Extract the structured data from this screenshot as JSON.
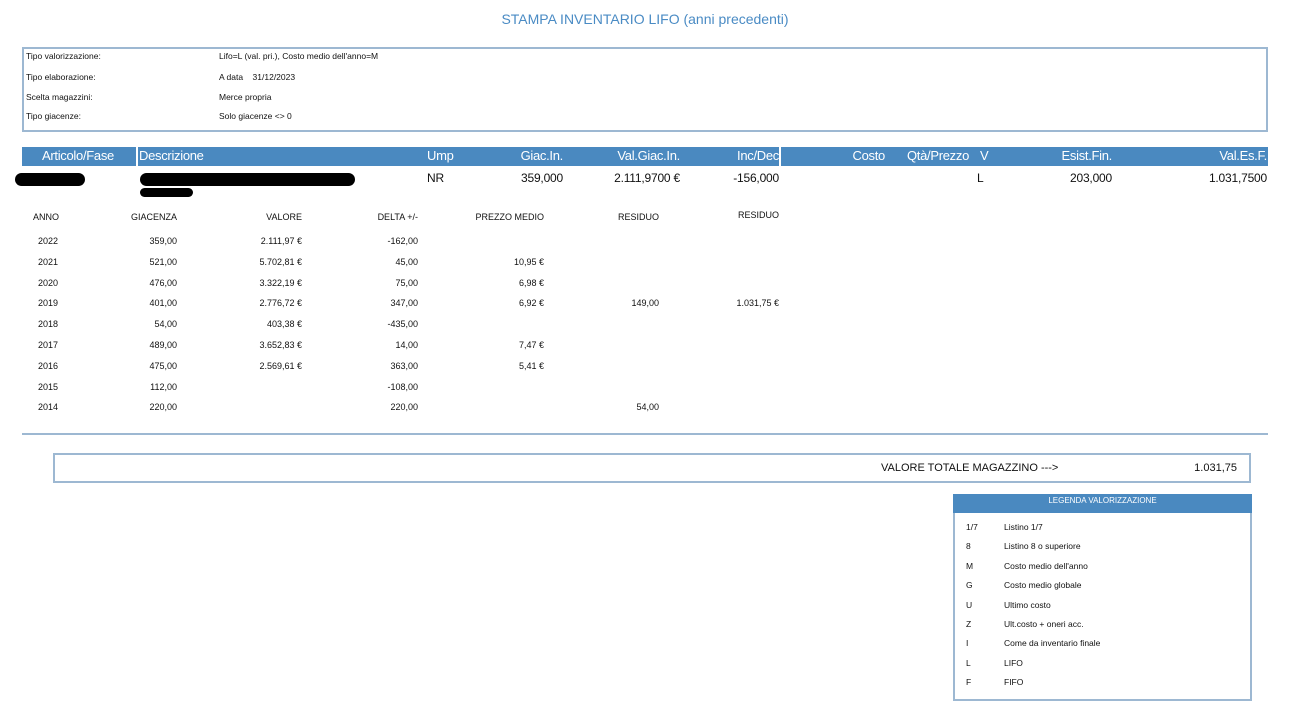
{
  "title": "STAMPA INVENTARIO LIFO (anni precedenti)",
  "info": [
    {
      "label": "Tipo valorizzazione:",
      "value": "Lifo=L (val. pri.), Costo medio dell'anno=M"
    },
    {
      "label": "Tipo elaborazione:",
      "value": "A data    31/12/2023"
    },
    {
      "label": "Scelta magazzini:",
      "value": "Merce propria"
    },
    {
      "label": "Tipo giacenze:",
      "value": "Solo giacenze <> 0"
    }
  ],
  "header": {
    "articolo": "Articolo/Fase",
    "descrizione": "Descrizione",
    "ump": "Ump",
    "giac_in": "Giac.In.",
    "val_giac_in": "Val.Giac.In.",
    "inc_dec": "Inc/Dec",
    "costo": "Costo",
    "qta_prezzo": "Qtà/Prezzo",
    "v": "V",
    "esist_fin": "Esist.Fin.",
    "val_es_f": "Val.Es.F."
  },
  "item": {
    "ump": "NR",
    "giac_in": "359,000",
    "val_giac_in": "2.111,9700 €",
    "inc_dec": "-156,000",
    "v": "L",
    "esist_fin": "203,000",
    "val_es_f": "1.031,7500"
  },
  "sub_header": [
    "ANNO",
    "GIACENZA",
    "VALORE",
    "DELTA +/-",
    "PREZZO MEDIO",
    "RESIDUO",
    "RESIDUO"
  ],
  "rows": [
    [
      "2022",
      "359,00",
      "2.111,97 €",
      "-162,00",
      "",
      "",
      ""
    ],
    [
      "2021",
      "521,00",
      "5.702,81 €",
      "45,00",
      "10,95 €",
      "",
      ""
    ],
    [
      "2020",
      "476,00",
      "3.322,19 €",
      "75,00",
      "6,98 €",
      "",
      ""
    ],
    [
      "2019",
      "401,00",
      "2.776,72 €",
      "347,00",
      "6,92 €",
      "149,00",
      "1.031,75 €"
    ],
    [
      "2018",
      "54,00",
      "403,38 €",
      "-435,00",
      "",
      "",
      ""
    ],
    [
      "2017",
      "489,00",
      "3.652,83 €",
      "14,00",
      "7,47 €",
      "",
      ""
    ],
    [
      "2016",
      "475,00",
      "2.569,61 €",
      "363,00",
      "5,41 €",
      "",
      ""
    ],
    [
      "2015",
      "112,00",
      "",
      "-108,00",
      "",
      "",
      ""
    ],
    [
      "2014",
      "220,00",
      "",
      "220,00",
      "",
      "54,00",
      ""
    ]
  ],
  "total": {
    "label": "VALORE TOTALE MAGAZZINO --->",
    "value": "1.031,75"
  },
  "legend": {
    "title": "LEGENDA VALORIZZAZIONE",
    "items": [
      {
        "code": "1/7",
        "label": "Listino 1/7"
      },
      {
        "code": "8",
        "label": "Listino 8 o superiore"
      },
      {
        "code": "M",
        "label": "Costo medio dell'anno"
      },
      {
        "code": "G",
        "label": "Costo medio globale"
      },
      {
        "code": "U",
        "label": "Ultimo costo"
      },
      {
        "code": "Z",
        "label": "Ult.costo + oneri acc."
      },
      {
        "code": "I",
        "label": "Come da inventario finale"
      },
      {
        "code": "L",
        "label": "LIFO"
      },
      {
        "code": "F",
        "label": "FIFO"
      }
    ]
  }
}
